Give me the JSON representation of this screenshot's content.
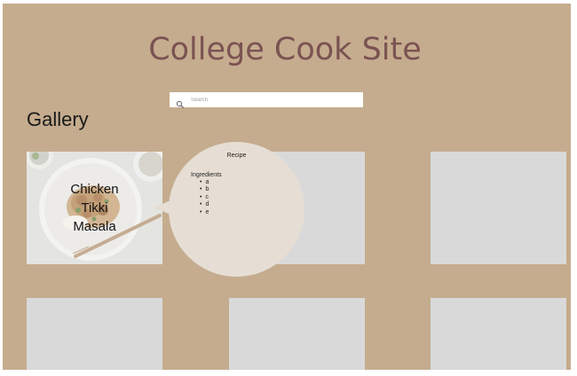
{
  "header": {
    "title": "College Cook Site"
  },
  "search": {
    "placeholder": "Search",
    "value": ""
  },
  "gallery": {
    "heading": "Gallery",
    "featured": {
      "title_line1": "Chicken",
      "title_line2": "Tikki",
      "title_line3": "Masala"
    }
  },
  "recipe_popup": {
    "title": "Recipe",
    "ingredients_label": "Ingredients",
    "ingredients": [
      "a",
      "b",
      "c",
      "d",
      "e"
    ]
  },
  "colors": {
    "page_background": "#c5ac8e",
    "title_color": "#7b5252",
    "placeholder_tile": "#d9d9d9",
    "popup_background": "#e6ded4"
  },
  "icons": {
    "search": "search-icon"
  }
}
